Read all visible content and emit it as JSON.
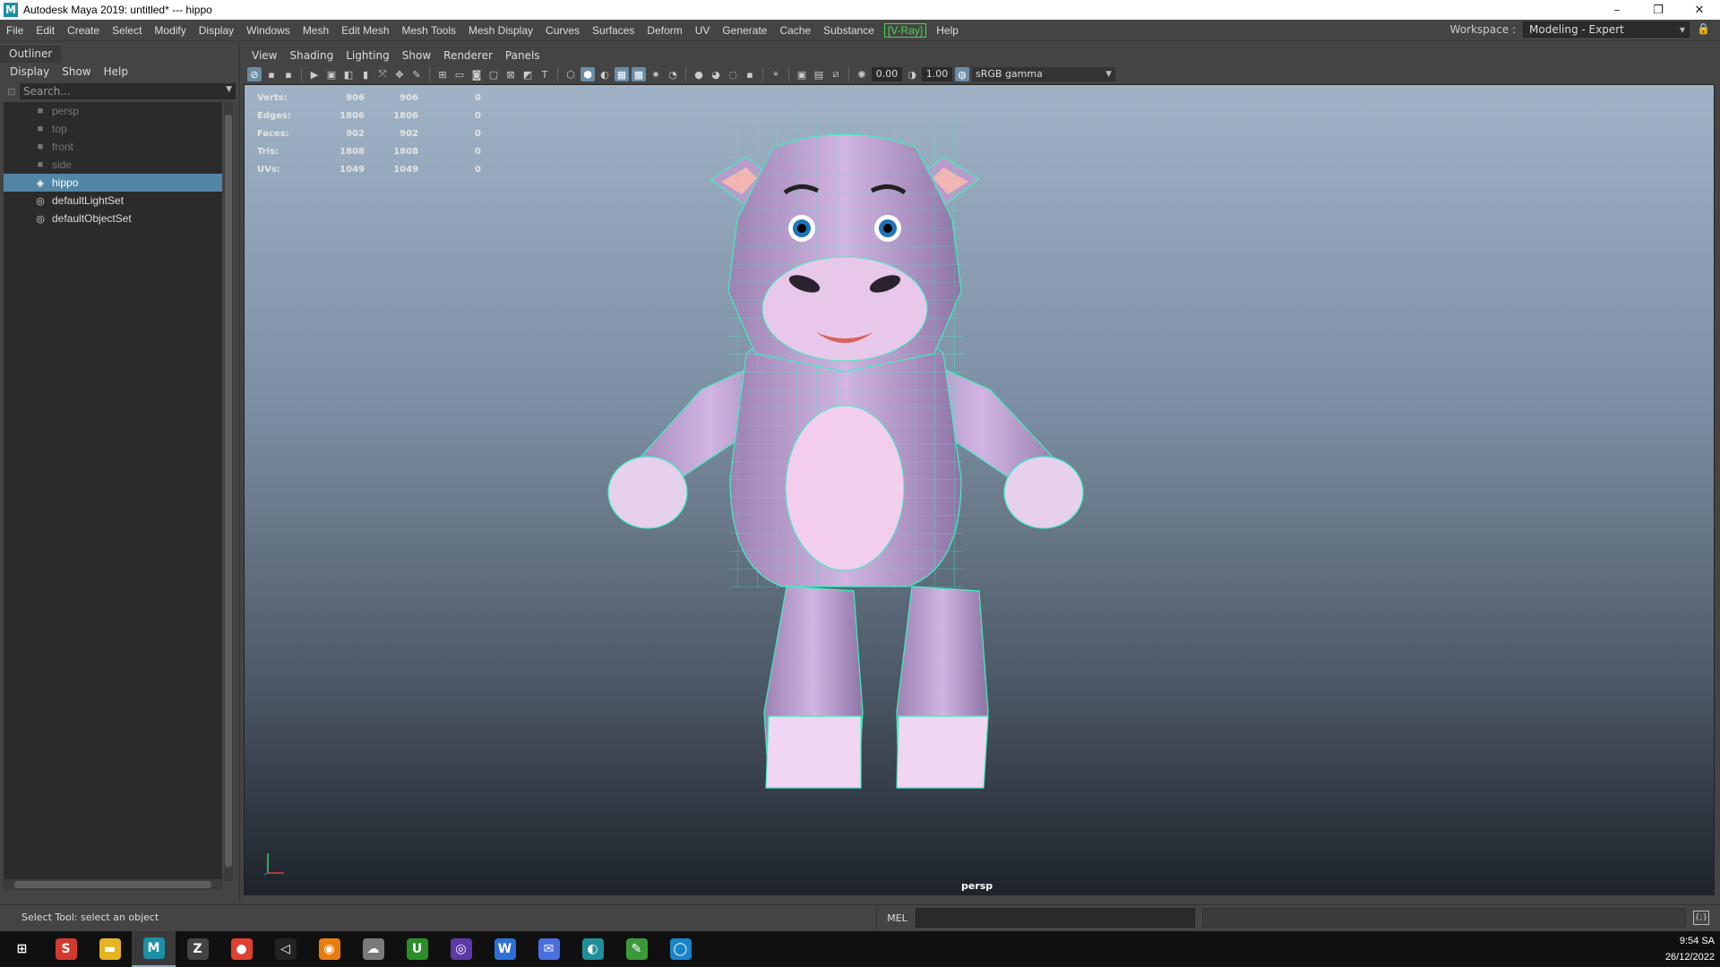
{
  "window": {
    "title": "Autodesk Maya 2019: untitled*   ---   hippo",
    "app_icon_letter": "M",
    "minimize": "–",
    "maximize": "❐",
    "close": "✕"
  },
  "menubar": {
    "items": [
      "File",
      "Edit",
      "Create",
      "Select",
      "Modify",
      "Display",
      "Windows",
      "Mesh",
      "Edit Mesh",
      "Mesh Tools",
      "Mesh Display",
      "Curves",
      "Surfaces",
      "Deform",
      "UV",
      "Generate",
      "Cache",
      "Substance"
    ],
    "vray": "[V-Ray]",
    "help": "Help",
    "workspace_label": "Workspace :",
    "workspace_value": "Modeling - Expert"
  },
  "outliner": {
    "title": "Outliner",
    "menu": [
      "Display",
      "Show",
      "Help"
    ],
    "search_placeholder": "Search...",
    "items": [
      {
        "label": "persp",
        "icon": "camera-icon",
        "dim": true,
        "selected": false
      },
      {
        "label": "top",
        "icon": "camera-icon",
        "dim": true,
        "selected": false
      },
      {
        "label": "front",
        "icon": "camera-icon",
        "dim": true,
        "selected": false
      },
      {
        "label": "side",
        "icon": "camera-icon",
        "dim": true,
        "selected": false
      },
      {
        "label": "hippo",
        "icon": "mesh-icon",
        "dim": false,
        "selected": true
      },
      {
        "label": "defaultLightSet",
        "icon": "set-icon",
        "dim": false,
        "selected": false
      },
      {
        "label": "defaultObjectSet",
        "icon": "set-icon",
        "dim": false,
        "selected": false
      }
    ]
  },
  "panel": {
    "menu": [
      "View",
      "Shading",
      "Lighting",
      "Show",
      "Renderer",
      "Panels"
    ],
    "exposure": "0.00",
    "gamma": "1.00",
    "color_space": "sRGB gamma"
  },
  "hud": {
    "rows": [
      {
        "label": "Verts:",
        "a": "906",
        "b": "906",
        "c": "0"
      },
      {
        "label": "Edges:",
        "a": "1806",
        "b": "1806",
        "c": "0"
      },
      {
        "label": "Faces:",
        "a": "902",
        "b": "902",
        "c": "0"
      },
      {
        "label": "Tris:",
        "a": "1808",
        "b": "1808",
        "c": "0"
      },
      {
        "label": "UVs:",
        "a": "1049",
        "b": "1049",
        "c": "0"
      }
    ],
    "camera": "persp"
  },
  "cmdline": {
    "help": "Select Tool: select an object",
    "lang": "MEL"
  },
  "taskbar": {
    "icons": [
      {
        "name": "windows-start-icon",
        "glyph": "⊞",
        "color": "#101010",
        "active": false
      },
      {
        "name": "app-icon-red",
        "glyph": "S",
        "color": "#d23a2f",
        "active": false
      },
      {
        "name": "file-explorer-icon",
        "glyph": "▬",
        "color": "#e6b422",
        "active": false
      },
      {
        "name": "maya-icon",
        "glyph": "M",
        "color": "#1b8fa6",
        "active": true
      },
      {
        "name": "zbrush-icon",
        "glyph": "Z",
        "color": "#444444",
        "active": false
      },
      {
        "name": "chrome-icon",
        "glyph": "●",
        "color": "#e0402f",
        "active": false
      },
      {
        "name": "unity-icon",
        "glyph": "◁",
        "color": "#222222",
        "active": false
      },
      {
        "name": "blender-icon",
        "glyph": "◉",
        "color": "#e87d0d",
        "active": false
      },
      {
        "name": "cloud-app-icon",
        "glyph": "☁",
        "color": "#7a7a7a",
        "active": false
      },
      {
        "name": "upwork-icon",
        "glyph": "U",
        "color": "#2a8f2a",
        "active": false
      },
      {
        "name": "github-icon",
        "glyph": "◎",
        "color": "#5b3aa5",
        "active": false
      },
      {
        "name": "w-app-icon",
        "glyph": "W",
        "color": "#2e6fd6",
        "active": false
      },
      {
        "name": "messenger-icon",
        "glyph": "✉",
        "color": "#4a6fe0",
        "active": false
      },
      {
        "name": "marmoset-icon",
        "glyph": "◐",
        "color": "#1f8f9a",
        "active": false
      },
      {
        "name": "green-app-icon",
        "glyph": "✎",
        "color": "#3a9a3a",
        "active": false
      },
      {
        "name": "steam-icon",
        "glyph": "◯",
        "color": "#1a84c8",
        "active": false
      }
    ],
    "time": "9:54 SA",
    "date": "26/12/2022"
  },
  "colors": {
    "selection": "#5285a6",
    "wireframe": "#3ff0c0",
    "body": "#c6a8d8",
    "belly": "#f0c8ec"
  }
}
